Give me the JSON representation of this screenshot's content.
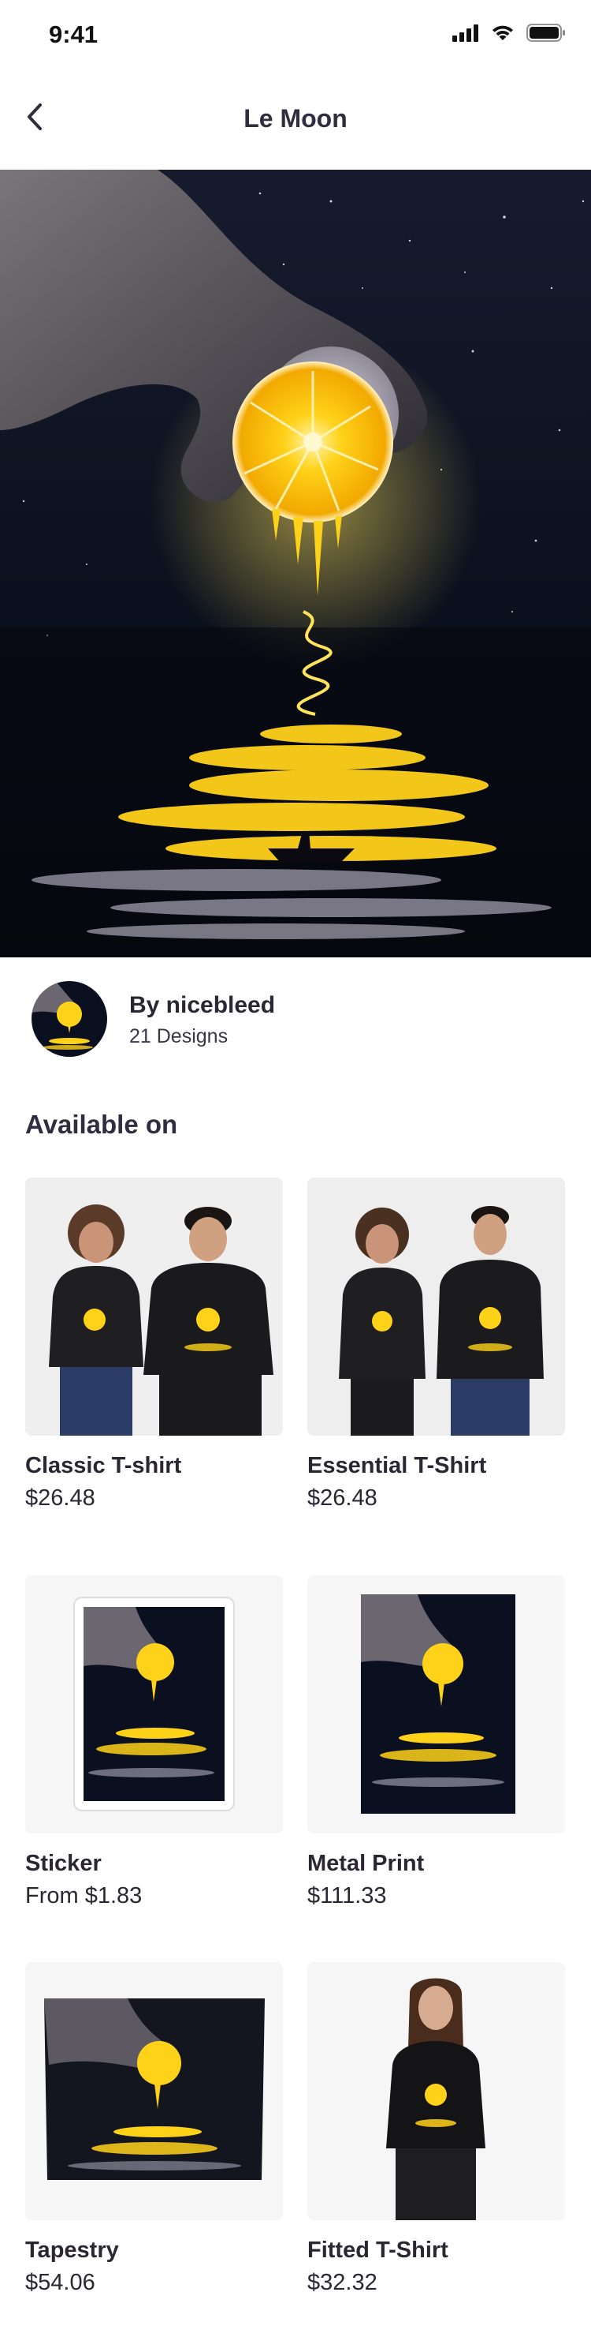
{
  "status": {
    "time": "9:41"
  },
  "nav": {
    "title": "Le Moon"
  },
  "artist": {
    "name": "By nicebleed",
    "designs": "21 Designs"
  },
  "available": {
    "title": "Available on"
  },
  "products": [
    {
      "name": "Classic T-shirt",
      "price": "$26.48"
    },
    {
      "name": "Essential T-Shirt",
      "price": "$26.48"
    },
    {
      "name": "Sticker",
      "price": "From $1.83"
    },
    {
      "name": "Metal Print",
      "price": "$111.33"
    },
    {
      "name": "Tapestry",
      "price": "$54.06"
    },
    {
      "name": "Fitted T-Shirt",
      "price": "$32.32"
    }
  ],
  "colors": {
    "accent": "#312d40",
    "lemon": "#ffd21a",
    "night": "#0b1020"
  }
}
